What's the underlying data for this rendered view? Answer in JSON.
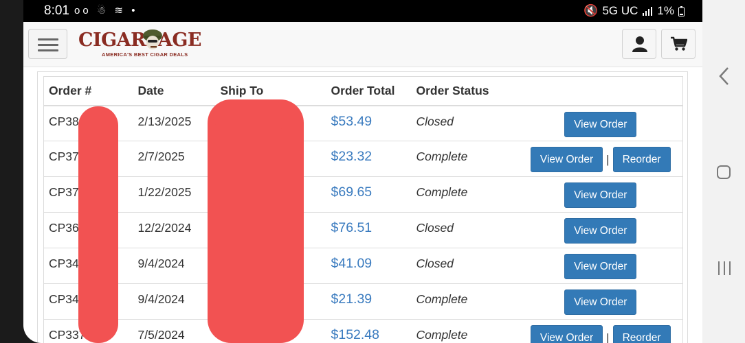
{
  "status_bar": {
    "time": "8:01",
    "left_icons": "oo ☃ ≋ •",
    "network": "5G UC",
    "battery": "1%"
  },
  "header": {
    "logo_text": "CIGARPAGE",
    "logo_tagline": "AMERICA'S BEST CIGAR DEALS",
    "menu_icon": "hamburger-icon",
    "user_icon": "user-icon",
    "cart_icon": "cart-icon"
  },
  "orders": {
    "columns": [
      "Order #",
      "Date",
      "Ship To",
      "Order Total",
      "Order Status",
      ""
    ],
    "rows": [
      {
        "order": "CP380",
        "date": "2/13/2025",
        "total": "$53.49",
        "status": "Closed",
        "view": "View Order",
        "reorder": ""
      },
      {
        "order": "CP37",
        "date": "2/7/2025",
        "total": "$23.32",
        "status": "Complete",
        "view": "View Order",
        "reorder": "Reorder"
      },
      {
        "order": "CP37",
        "date": "1/22/2025",
        "total": "$69.65",
        "status": "Complete",
        "view": "View Order",
        "reorder": ""
      },
      {
        "order": "CP36",
        "date": "12/2/2024",
        "total": "$76.51",
        "status": "Closed",
        "view": "View Order",
        "reorder": ""
      },
      {
        "order": "CP34",
        "date": "9/4/2024",
        "total": "$41.09",
        "status": "Closed",
        "view": "View Order",
        "reorder": ""
      },
      {
        "order": "CP349",
        "date": "9/4/2024",
        "total": "$21.39",
        "status": "Complete",
        "view": "View Order",
        "reorder": ""
      },
      {
        "order": "CP337",
        "date": "7/5/2024",
        "total": "$152.48",
        "status": "Complete",
        "view": "View Order",
        "reorder": "Reorder"
      }
    ]
  },
  "colors": {
    "link_blue": "#3a7bbf",
    "button_blue": "#337ab7",
    "brand_red": "#8a2c22",
    "redaction": "#f25252"
  }
}
